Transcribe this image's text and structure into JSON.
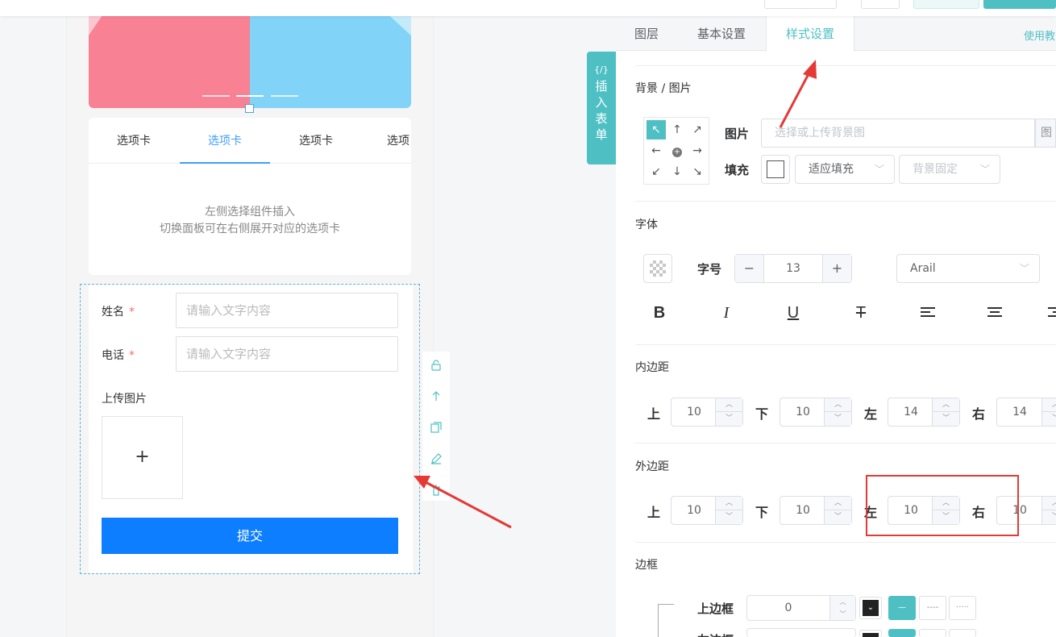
{
  "colors": {
    "accent": "#4ec0c4",
    "primary_blue": "#0d7eff",
    "tab_blue": "#409eff",
    "annotation_red": "#e53935",
    "banner_pink": "#f98194",
    "banner_blue": "#81d4f8"
  },
  "canvas": {
    "tabs": [
      "选项卡",
      "选项卡",
      "选项卡",
      "选项"
    ],
    "active_tab_index": 1,
    "tabs_empty_line1": "左侧选择组件插入",
    "tabs_empty_line2": "切换面板可在右侧展开对应的选项卡",
    "form": {
      "name_label": "姓名",
      "phone_label": "电话",
      "required_mark": "*",
      "name_placeholder": "请输入文字内容",
      "phone_placeholder": "请输入文字内容",
      "upload_label": "上传图片",
      "upload_plus": "+",
      "submit_label": "提交"
    },
    "side_tools": [
      "unlock-icon",
      "arrow-up-icon",
      "copy-icon",
      "edit-icon",
      "delete-icon"
    ]
  },
  "insert_tab": {
    "code": "{/}",
    "label": "插入表单"
  },
  "panel": {
    "tabs": [
      "图层",
      "基本设置",
      "样式设置"
    ],
    "active_tab": "样式设置",
    "help_link": "使用教",
    "background": {
      "title": "背景 / 图片",
      "image_label": "图片",
      "image_placeholder": "选择或上传背景图",
      "image_button": "图",
      "fill_label": "填充",
      "fill_mode": "适应填充",
      "fixed_mode": "背景固定",
      "position_selected": "top-left"
    },
    "font": {
      "title": "字体",
      "size_label": "字号",
      "size_value": "13",
      "minus": "−",
      "plus": "+",
      "family": "Arail",
      "format_buttons": [
        "bold-icon",
        "italic-icon",
        "underline-icon",
        "strikethrough-icon",
        "align-left-icon",
        "align-center-icon",
        "align-right-icon"
      ]
    },
    "padding": {
      "title": "内边距",
      "top_label": "上",
      "top": "10",
      "bottom_label": "下",
      "bottom": "10",
      "left_label": "左",
      "left": "14",
      "right_label": "右",
      "right": "14"
    },
    "margin": {
      "title": "外边距",
      "top_label": "上",
      "top": "10",
      "bottom_label": "下",
      "bottom": "10",
      "left_label": "左",
      "left": "10",
      "right_label": "右",
      "right": "10"
    },
    "border": {
      "title": "边框",
      "top_label": "上边框",
      "top_value": "0",
      "next_label": "左边框"
    }
  }
}
